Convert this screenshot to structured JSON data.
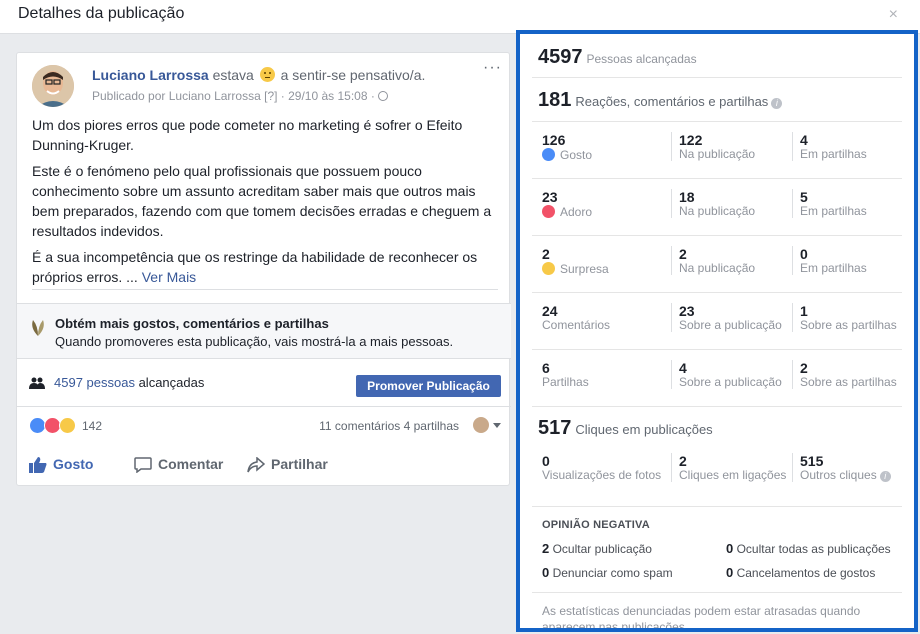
{
  "dialog": {
    "title": "Detalhes da publicação",
    "close_label": "×"
  },
  "post": {
    "author": "Luciano Larrossa",
    "feeling_prefix": "estava",
    "feeling_text": "a sentir-se pensativo/a.",
    "meta": "Publicado por Luciano Larrossa [?] · 29/10 às 15:08 ·",
    "more_label": "···",
    "paragraphs": [
      "Um dos piores erros que pode cometer no marketing é sofrer o Efeito Dunning-Kruger.",
      "Este é o fenómeno pelo qual profissionais que possuem pouco conhecimento sobre um assunto acreditam saber mais que outros mais bem preparados, fazendo com que tomem decisões erradas e cheguem a resultados indevidos.",
      "É a sua incompetência que os restringe da habilidade de reconhecer os próprios erros. ..."
    ],
    "see_more": "Ver Mais",
    "promo_title": "Obtém mais gostos, comentários e partilhas",
    "promo_desc": "Quando promoveres esta publicação, vais mostrá-la a mais pessoas.",
    "reach_link": "4597 pessoas",
    "reach_suffix": "alcançadas",
    "promote_button": "Promover Publicação",
    "reaction_count": "142",
    "comments_shares": "11 comentários  4 partilhas",
    "actions": {
      "like": "Gosto",
      "comment": "Comentar",
      "share": "Partilhar"
    }
  },
  "insights": {
    "reach": {
      "value": "4597",
      "label": "Pessoas alcançadas"
    },
    "engagement": {
      "value": "181",
      "label": "Reações, comentários e partilhas"
    },
    "rows": [
      {
        "total": "126",
        "label": "Gosto",
        "icon": "like",
        "on_post": "122",
        "on_post_label": "Na publicação",
        "on_shares": "4",
        "on_shares_label": "Em partilhas"
      },
      {
        "total": "23",
        "label": "Adoro",
        "icon": "love",
        "on_post": "18",
        "on_post_label": "Na publicação",
        "on_shares": "5",
        "on_shares_label": "Em partilhas"
      },
      {
        "total": "2",
        "label": "Surpresa",
        "icon": "wow",
        "on_post": "2",
        "on_post_label": "Na publicação",
        "on_shares": "0",
        "on_shares_label": "Em partilhas"
      },
      {
        "total": "24",
        "label": "Comentários",
        "icon": "",
        "on_post": "23",
        "on_post_label": "Sobre a publicação",
        "on_shares": "1",
        "on_shares_label": "Sobre as partilhas"
      },
      {
        "total": "6",
        "label": "Partilhas",
        "icon": "",
        "on_post": "4",
        "on_post_label": "Sobre a publicação",
        "on_shares": "2",
        "on_shares_label": "Sobre as partilhas"
      }
    ],
    "clicks": {
      "value": "517",
      "label": "Cliques em publicações",
      "photo_views": "0",
      "photo_views_label": "Visualizações de fotos",
      "link_clicks": "2",
      "link_clicks_label": "Cliques em ligações",
      "other_clicks": "515",
      "other_clicks_label": "Outros cliques"
    },
    "negative": {
      "title": "OPINIÃO NEGATIVA",
      "hide_post": "2",
      "hide_post_label": "Ocultar publicação",
      "hide_all": "0",
      "hide_all_label": "Ocultar todas as publicações",
      "spam": "0",
      "spam_label": "Denunciar como spam",
      "unlike": "0",
      "unlike_label": "Cancelamentos de gostos"
    },
    "footnote": "As estatísticas denunciadas podem estar atrasadas quando aparecem nas publicações"
  }
}
